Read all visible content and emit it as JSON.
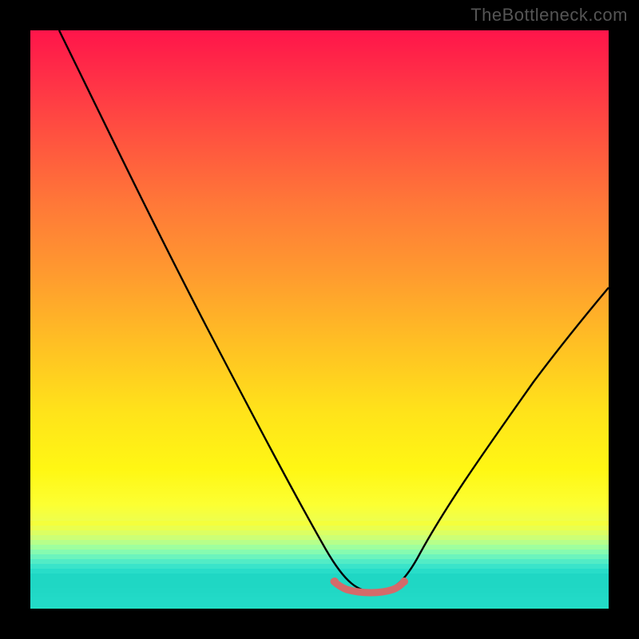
{
  "watermark": "TheBottleneck.com",
  "chart_data": {
    "type": "line",
    "title": "",
    "xlabel": "",
    "ylabel": "",
    "xlim": [
      0,
      100
    ],
    "ylim": [
      0,
      100
    ],
    "series": [
      {
        "name": "bottleneck-curve",
        "x": [
          5,
          10,
          15,
          20,
          25,
          30,
          35,
          40,
          45,
          50,
          53,
          55,
          58,
          60,
          63,
          65,
          70,
          75,
          80,
          85,
          90,
          95,
          100
        ],
        "y": [
          100,
          91,
          82,
          73,
          64,
          56,
          47,
          39,
          30,
          21,
          14,
          9,
          5,
          3,
          3,
          5,
          10,
          17,
          24,
          31,
          38,
          45,
          52
        ]
      },
      {
        "name": "optimal-plateau",
        "x": [
          55,
          56,
          57,
          58,
          59,
          60,
          61,
          62,
          63,
          64
        ],
        "y": [
          4.2,
          3.6,
          3.2,
          3.0,
          2.9,
          2.9,
          3.0,
          3.2,
          3.8,
          4.6
        ]
      }
    ],
    "colors": {
      "gradient_top": "#ff154a",
      "gradient_mid": "#ffd81e",
      "gradient_bottom": "#1fe0c4",
      "curve": "#000000",
      "plateau": "#d46a6a",
      "frame": "#000000"
    }
  }
}
